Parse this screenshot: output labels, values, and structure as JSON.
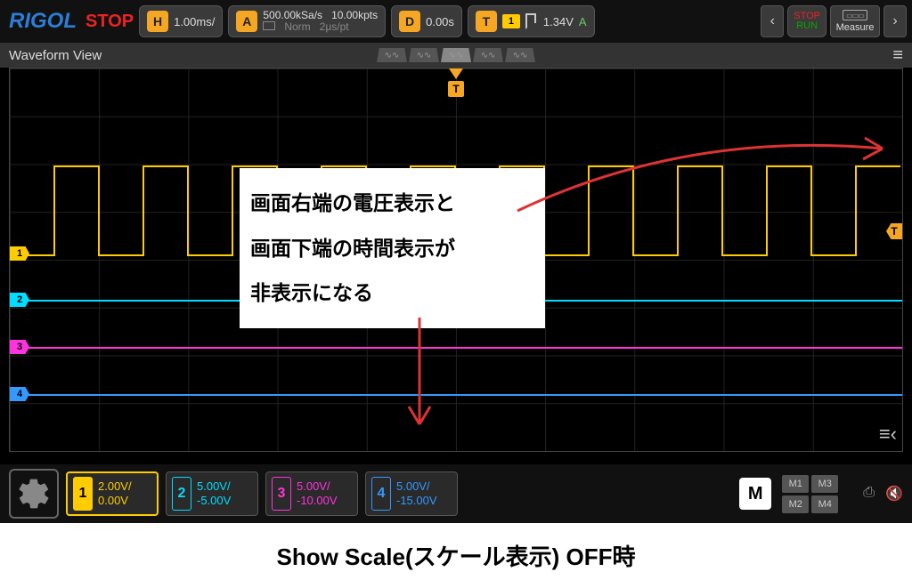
{
  "topbar": {
    "brand": "RIGOL",
    "status": "STOP",
    "timebase": {
      "letter": "H",
      "value": "1.00ms/"
    },
    "acquire": {
      "letter": "A",
      "rate": "500.00kSa/s",
      "depth": "10.00kpts",
      "mode": "Norm",
      "resolution": "2μs/pt"
    },
    "delay": {
      "letter": "D",
      "value": "0.00s"
    },
    "trigger": {
      "letter": "T",
      "chan": "1",
      "level": "1.34V",
      "coupling": "A"
    },
    "stoprun": {
      "stop": "STOP",
      "run": "RUN"
    },
    "measure": "Measure"
  },
  "waveform_header": {
    "title": "Waveform View"
  },
  "channels": [
    {
      "n": "1",
      "scale": "2.00V/",
      "offset": "0.00V",
      "color": "#fc0",
      "pos": 208
    },
    {
      "n": "2",
      "scale": "5.00V/",
      "offset": "-5.00V",
      "color": "#0df",
      "pos": 260
    },
    {
      "n": "3",
      "scale": "5.00V/",
      "offset": "-10.00V",
      "color": "#f3d",
      "pos": 313
    },
    {
      "n": "4",
      "scale": "5.00V/",
      "offset": "-15.00V",
      "color": "#39f",
      "pos": 366
    }
  ],
  "trigger_marker": {
    "label": "T"
  },
  "annotation": {
    "line1": "画面右端の電圧表示と",
    "line2": "画面下端の時間表示が",
    "line3": "非表示になる"
  },
  "dock": {
    "math": "M",
    "m1": "M1",
    "m2": "M2",
    "m3": "M3",
    "m4": "M4"
  },
  "caption": "Show Scale(スケール表示) OFF時",
  "chart_data": {
    "type": "line",
    "title": "Waveform View",
    "xlabel": "",
    "ylabel": "",
    "x_units": "ms",
    "timebase_per_div": 1.0,
    "trigger_level_V": 1.34,
    "series": [
      {
        "name": "CH1",
        "color": "#fc0",
        "scale_V_per_div": 2.0,
        "offset_V": 0.0,
        "waveform": "square",
        "amplitude_V": 2.7,
        "period_ms": 1.0
      },
      {
        "name": "CH2",
        "color": "#0df",
        "scale_V_per_div": 5.0,
        "offset_V": -5.0,
        "waveform": "flat",
        "value_V": 0
      },
      {
        "name": "CH3",
        "color": "#f3d",
        "scale_V_per_div": 5.0,
        "offset_V": -10.0,
        "waveform": "flat",
        "value_V": 0
      },
      {
        "name": "CH4",
        "color": "#39f",
        "scale_V_per_div": 5.0,
        "offset_V": -15.0,
        "waveform": "flat",
        "value_V": 0
      }
    ]
  }
}
